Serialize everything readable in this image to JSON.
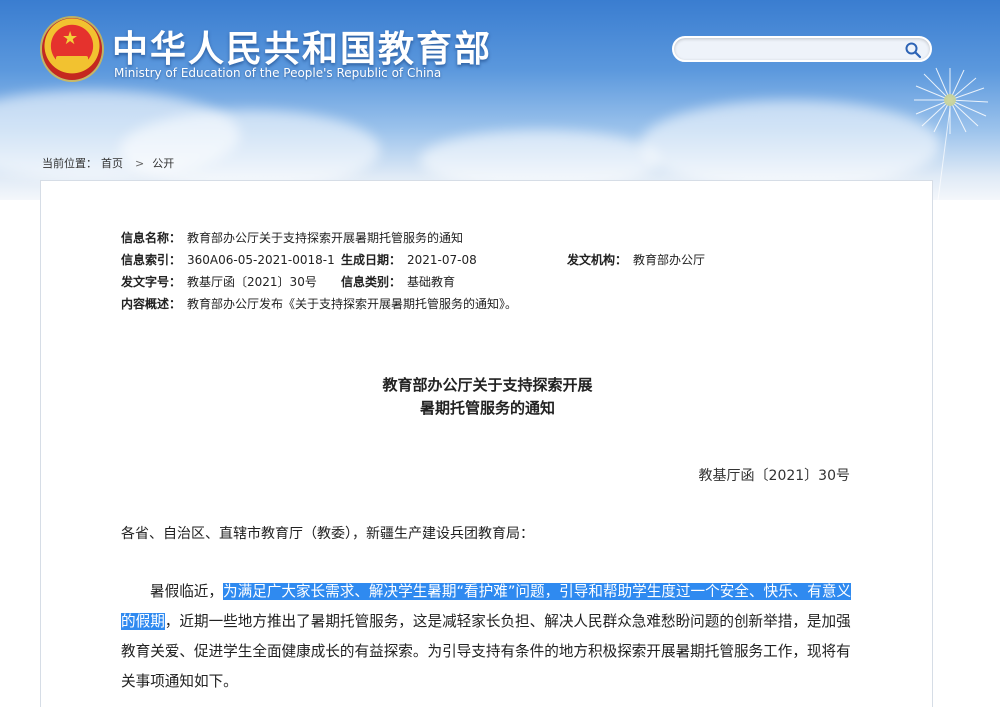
{
  "header": {
    "site_title": "中华人民共和国教育部",
    "site_subtitle": "Ministry of Education of the People's Republic of China",
    "search_placeholder": ""
  },
  "breadcrumb": {
    "prefix": "当前位置：",
    "items": [
      "首页",
      "公开"
    ],
    "separator": ">"
  },
  "meta": {
    "info_name_label": "信息名称：",
    "info_name_value": "教育部办公厅关于支持探索开展暑期托管服务的通知",
    "index_label": "信息索引：",
    "index_value": "360A06-05-2021-0018-1",
    "date_label": "生成日期：",
    "date_value": "2021-07-08",
    "issuer_label": "发文机构：",
    "issuer_value": "教育部办公厅",
    "doc_no_label": "发文字号：",
    "doc_no_value": "教基厅函〔2021〕30号",
    "category_label": "信息类别：",
    "category_value": "基础教育",
    "summary_label": "内容概述：",
    "summary_value": "教育部办公厅发布《关于支持探索开展暑期托管服务的通知》。"
  },
  "document": {
    "title_line1": "教育部办公厅关于支持探索开展",
    "title_line2": "暑期托管服务的通知",
    "doc_number": "教基厅函〔2021〕30号",
    "addressee": "各省、自治区、直辖市教育厅（教委），新疆生产建设兵团教育局：",
    "para_intro": "暑假临近，",
    "para_highlight": "为满足广大家长需求、解决学生暑期“看护难”问题，引导和帮助学生度过一个安全、快乐、有意义的假期",
    "para_rest": "，近期一些地方推出了暑期托管服务，这是减轻家长负担、解决人民群众急难愁盼问题的创新举措，是加强教育关爱、促进学生全面健康成长的有益探索。为引导支持有条件的地方积极探索开展暑期托管服务工作，现将有关事项通知如下。"
  },
  "colors": {
    "banner_top": "#3a7dd0",
    "highlight": "#2f8af0",
    "text": "#222222"
  }
}
